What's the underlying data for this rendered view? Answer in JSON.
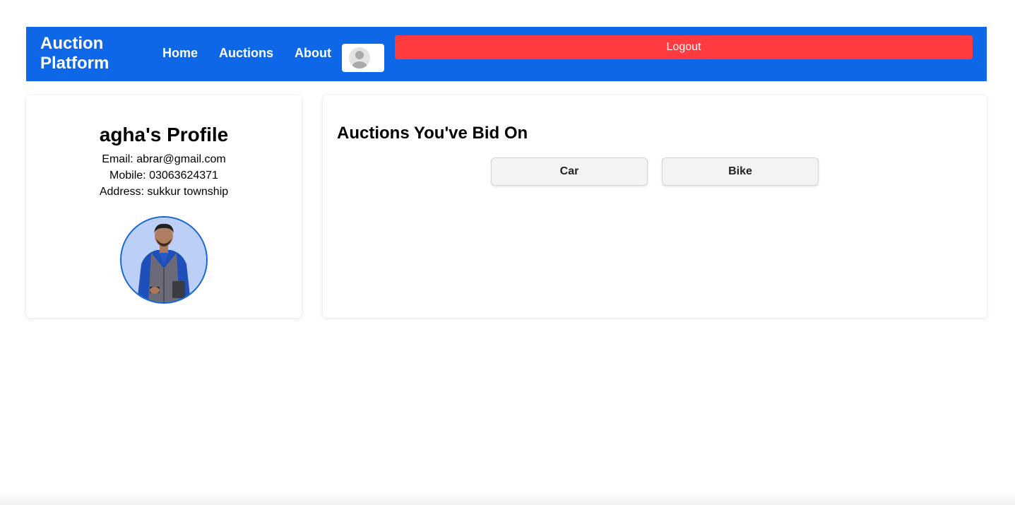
{
  "navbar": {
    "brand": "Auction Platform",
    "links": [
      "Home",
      "Auctions",
      "About"
    ],
    "logout_label": "Logout",
    "colors": {
      "background": "#0e67e6",
      "logout": "#ff3b3f"
    }
  },
  "profile": {
    "title": "agha's Profile",
    "email_line": "Email: abrar@gmail.com",
    "mobile_line": "Mobile: 03063624371",
    "address_line": "Address: sukkur township"
  },
  "bids": {
    "title": "Auctions You've Bid On",
    "items": [
      "Car",
      "Bike"
    ]
  }
}
